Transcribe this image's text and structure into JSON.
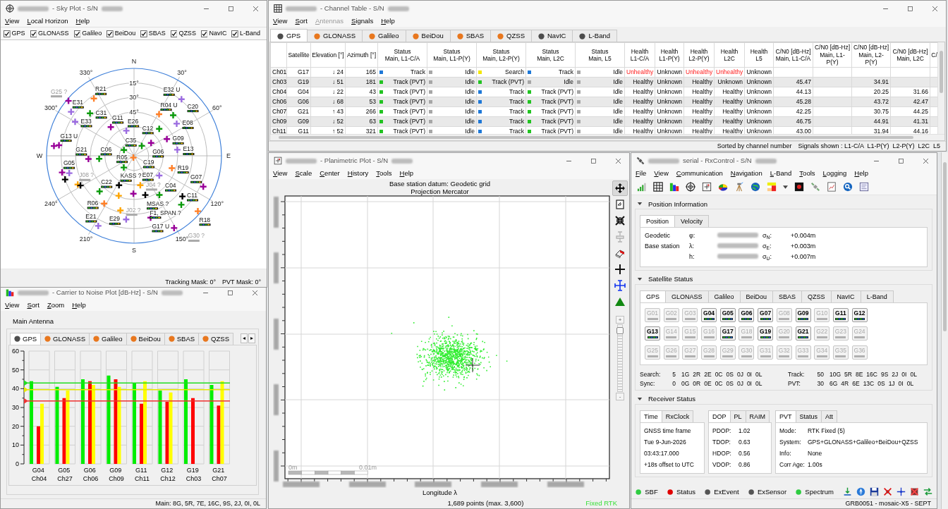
{
  "windows": [
    {
      "kind": "skyplot",
      "title": "- Sky Plot - S/N",
      "menu": [
        "View",
        "Local Horizon",
        "Help"
      ],
      "filters": [
        {
          "label": "GPS",
          "checked": true
        },
        {
          "label": "GLONASS",
          "checked": true
        },
        {
          "label": "Galileo",
          "checked": true
        },
        {
          "label": "BeiDou",
          "checked": true
        },
        {
          "label": "SBAS",
          "checked": true
        },
        {
          "label": "QZSS",
          "checked": true
        },
        {
          "label": "NavIC",
          "checked": true
        },
        {
          "label": "L-Band",
          "checked": true
        }
      ],
      "sky_plot": {
        "compass_labels": [
          "N",
          "30°",
          "60°",
          "E",
          "120°",
          "150°",
          "S",
          "210°",
          "240°",
          "W",
          "300°",
          "330°"
        ],
        "ring_labels": [
          "15°",
          "30°",
          "45°"
        ],
        "satellites": [
          {
            "label": "G25 ?",
            "color": "#990099",
            "tracked": false
          },
          {
            "label": "R21",
            "color": "#ff7f27",
            "tracked": true
          },
          {
            "label": "E31",
            "color": "#9b6ce0",
            "tracked": true
          },
          {
            "label": "C31",
            "color": "#0a9a0a",
            "tracked": true
          },
          {
            "label": "E33",
            "color": "#9b6ce0",
            "tracked": true
          },
          {
            "label": "E32 U",
            "color": "#9b6ce0",
            "tracked": true
          },
          {
            "label": "R04 U",
            "color": "#ff7f27",
            "tracked": true
          },
          {
            "label": "E08",
            "color": "#9b6ce0",
            "tracked": true
          },
          {
            "label": "C20",
            "color": "#0a9a0a",
            "tracked": true
          },
          {
            "label": "G11",
            "color": "#990099",
            "tracked": true
          },
          {
            "label": "E26",
            "color": "#9b6ce0",
            "tracked": true
          },
          {
            "label": "C12",
            "color": "#0a9a0a",
            "tracked": true
          },
          {
            "label": "G06",
            "color": "#990099",
            "tracked": true
          },
          {
            "label": "G09",
            "color": "#990099",
            "tracked": true
          },
          {
            "label": "G13 U",
            "color": "#990099",
            "tracked": true
          },
          {
            "label": "E13",
            "color": "#9b6ce0",
            "tracked": true
          },
          {
            "label": "C35",
            "color": "#0a9a0a",
            "tracked": true
          },
          {
            "label": "C19",
            "color": "#0a9a0a",
            "tracked": true
          },
          {
            "label": "R05",
            "color": "#ff7f27",
            "tracked": true
          },
          {
            "label": "G21",
            "color": "#990099",
            "tracked": true
          },
          {
            "label": "C06",
            "color": "#0a9a0a",
            "tracked": true
          },
          {
            "label": "R19",
            "color": "#ff7f27",
            "tracked": true
          },
          {
            "label": "E07",
            "color": "#9b6ce0",
            "tracked": true
          },
          {
            "label": "G05",
            "color": "#990099",
            "tracked": true
          },
          {
            "label": "J08 ?",
            "color": "#ffa500",
            "tracked": false
          },
          {
            "label": "C22",
            "color": "#0a9a0a",
            "tracked": true
          },
          {
            "label": "KASS ?",
            "color": "#000000",
            "tracked": true
          },
          {
            "label": "J04 ?",
            "color": "#ffa500",
            "tracked": false
          },
          {
            "label": "MSAS ?",
            "color": "#000000",
            "tracked": true
          },
          {
            "label": "C04",
            "color": "#0a9a0a",
            "tracked": true
          },
          {
            "label": "G07",
            "color": "#990099",
            "tracked": true
          },
          {
            "label": "F1, SPAN ?",
            "color": "#000000",
            "tracked": true
          },
          {
            "label": "R06",
            "color": "#ff7f27",
            "tracked": true
          },
          {
            "label": "C11",
            "color": "#0a9a0a",
            "tracked": true
          },
          {
            "label": "R18",
            "color": "#ff7f27",
            "tracked": true
          },
          {
            "label": "J02 ?",
            "color": "#ffa500",
            "tracked": false
          },
          {
            "label": "E29",
            "color": "#9b6ce0",
            "tracked": true
          },
          {
            "label": "G17 U",
            "color": "#990099",
            "tracked": true
          },
          {
            "label": "E21",
            "color": "#9b6ce0",
            "tracked": true
          },
          {
            "label": "G30 ?",
            "color": "#990099",
            "tracked": false
          }
        ],
        "unlabeled_markers": [
          {
            "color": "#990099"
          },
          {
            "color": "#990099"
          },
          {
            "color": "#9b6ce0"
          },
          {
            "color": "#0a9a0a"
          },
          {
            "color": "#000000"
          },
          {
            "color": "#000000"
          },
          {
            "color": "#ffa500"
          }
        ]
      },
      "status_bar": [
        "Tracking Mask: 0°",
        "PVT Mask: 0°"
      ]
    },
    {
      "kind": "channels",
      "title": "- Channel Table - S/N",
      "menu": [
        {
          "label": "View",
          "disabled": false
        },
        {
          "label": "Sort",
          "disabled": false
        },
        {
          "label": "Antennas",
          "disabled": true
        },
        {
          "label": "Signals",
          "disabled": false
        },
        {
          "label": "Help",
          "disabled": false
        }
      ],
      "tabs": [
        {
          "label": "GPS",
          "selected": true,
          "color": "#4d4d4d"
        },
        {
          "label": "GLONASS",
          "selected": false,
          "color": "#e8771e"
        },
        {
          "label": "Galileo",
          "selected": false,
          "color": "#e8771e"
        },
        {
          "label": "BeiDou",
          "selected": false,
          "color": "#e8771e"
        },
        {
          "label": "SBAS",
          "selected": false,
          "color": "#e8771e"
        },
        {
          "label": "QZSS",
          "selected": false,
          "color": "#e8771e"
        },
        {
          "label": "NavIC",
          "selected": false,
          "color": "#4d4d4d"
        },
        {
          "label": "L-Band",
          "selected": false,
          "color": "#4d4d4d"
        }
      ],
      "columns": [
        "Satellite",
        "Elevation [°]",
        "Azimuth [°]",
        "Status\nMain, L1-C/A",
        "Status\nMain, L1-P(Y)",
        "Status\nMain, L2-P(Y)",
        "Status\nMain, L2C",
        "Status\nMain, L5",
        "Health\nL1-C/A",
        "Health\nL1-P(Y)",
        "Health\nL2-P(Y)",
        "Health\nL2C",
        "Health\nL5",
        "C/N0 [dB-Hz]\nMain, L1-C/A",
        "C/N0 [dB-Hz]\nMain, L1-P(Y)",
        "C/N0 [dB-Hz]\nMain, L2-P(Y)",
        "C/N0 [dB-Hz]\nMain, L2C",
        "C/"
      ],
      "rows": [
        {
          "channel": "Ch01",
          "satellite": "G17",
          "elevation": "↓ 24",
          "azimuth": "165",
          "status": [
            {
              "text": "Track",
              "color": "#1e78d7"
            },
            {
              "text": "Idle",
              "color": "#a6a6a6"
            },
            {
              "text": "Search",
              "color": "#f2e600"
            },
            {
              "text": "Track",
              "color": "#1e78d7"
            },
            {
              "text": "Idle",
              "color": "#a6a6a6"
            }
          ],
          "health": [
            {
              "text": "Unhealthy",
              "alert": true
            },
            {
              "text": "Unknown",
              "alert": false
            },
            {
              "text": "Unhealthy",
              "alert": true
            },
            {
              "text": "Unhealthy",
              "alert": true
            },
            {
              "text": "Unknown",
              "alert": false
            }
          ]
        },
        {
          "channel": "Ch03",
          "satellite": "G19",
          "elevation": "↓ 51",
          "azimuth": "181",
          "status": [
            {
              "text": "Track (PVT)",
              "color": "#22c322"
            },
            {
              "text": "Idle",
              "color": "#a6a6a6"
            },
            {
              "text": "Track (PVT)",
              "color": "#22c322"
            },
            {
              "text": "Idle",
              "color": "#a6a6a6"
            },
            {
              "text": "Idle",
              "color": "#a6a6a6"
            }
          ],
          "health": [
            {
              "text": "Healthy",
              "alert": false
            },
            {
              "text": "Unknown",
              "alert": false
            },
            {
              "text": "Healthy",
              "alert": false
            },
            {
              "text": "Unknown",
              "alert": false
            },
            {
              "text": "Unknown",
              "alert": false
            }
          ],
          "cn0": {
            "main_l1ca": "45.47",
            "main_l2py": "34.91"
          }
        },
        {
          "channel": "Ch04",
          "satellite": "G04",
          "elevation": "↓ 22",
          "azimuth": "43",
          "status": [
            {
              "text": "Track (PVT)",
              "color": "#22c322"
            },
            {
              "text": "Idle",
              "color": "#a6a6a6"
            },
            {
              "text": "Track",
              "color": "#1e78d7"
            },
            {
              "text": "Track (PVT)",
              "color": "#22c322"
            },
            {
              "text": "Idle",
              "color": "#a6a6a6"
            }
          ],
          "health": [
            {
              "text": "Healthy",
              "alert": false
            },
            {
              "text": "Unknown",
              "alert": false
            },
            {
              "text": "Healthy",
              "alert": false
            },
            {
              "text": "Healthy",
              "alert": false
            },
            {
              "text": "Unknown",
              "alert": false
            }
          ],
          "cn0": {
            "main_l1ca": "44.13",
            "main_l2py": "20.25",
            "main_l2c": "31.66"
          }
        },
        {
          "channel": "Ch06",
          "satellite": "G06",
          "elevation": "↓ 68",
          "azimuth": "53",
          "status": [
            {
              "text": "Track (PVT)",
              "color": "#22c322"
            },
            {
              "text": "Idle",
              "color": "#a6a6a6"
            },
            {
              "text": "Track",
              "color": "#1e78d7"
            },
            {
              "text": "Track (PVT)",
              "color": "#22c322"
            },
            {
              "text": "Idle",
              "color": "#a6a6a6"
            }
          ],
          "health": [
            {
              "text": "Healthy",
              "alert": false
            },
            {
              "text": "Unknown",
              "alert": false
            },
            {
              "text": "Healthy",
              "alert": false
            },
            {
              "text": "Healthy",
              "alert": false
            },
            {
              "text": "Unknown",
              "alert": false
            }
          ],
          "cn0": {
            "main_l1ca": "45.28",
            "main_l2py": "43.72",
            "main_l2c": "42.47"
          }
        },
        {
          "channel": "Ch07",
          "satellite": "G21",
          "elevation": "↑ 43",
          "azimuth": "266",
          "status": [
            {
              "text": "Track (PVT)",
              "color": "#22c322"
            },
            {
              "text": "Idle",
              "color": "#a6a6a6"
            },
            {
              "text": "Track",
              "color": "#1e78d7"
            },
            {
              "text": "Track (PVT)",
              "color": "#22c322"
            },
            {
              "text": "Idle",
              "color": "#a6a6a6"
            }
          ],
          "health": [
            {
              "text": "Healthy",
              "alert": false
            },
            {
              "text": "Unknown",
              "alert": false
            },
            {
              "text": "Healthy",
              "alert": false
            },
            {
              "text": "Healthy",
              "alert": false
            },
            {
              "text": "Unknown",
              "alert": false
            }
          ],
          "cn0": {
            "main_l1ca": "42.25",
            "main_l2py": "30.75",
            "main_l2c": "44.25"
          }
        },
        {
          "channel": "Ch09",
          "satellite": "G09",
          "elevation": "↓ 52",
          "azimuth": "63",
          "status": [
            {
              "text": "Track (PVT)",
              "color": "#22c322"
            },
            {
              "text": "Idle",
              "color": "#a6a6a6"
            },
            {
              "text": "Track",
              "color": "#1e78d7"
            },
            {
              "text": "Track (PVT)",
              "color": "#22c322"
            },
            {
              "text": "Idle",
              "color": "#a6a6a6"
            }
          ],
          "health": [
            {
              "text": "Healthy",
              "alert": false
            },
            {
              "text": "Unknown",
              "alert": false
            },
            {
              "text": "Healthy",
              "alert": false
            },
            {
              "text": "Healthy",
              "alert": false
            },
            {
              "text": "Unknown",
              "alert": false
            }
          ],
          "cn0": {
            "main_l1ca": "46.75",
            "main_l2py": "44.91",
            "main_l2c": "41.31"
          }
        },
        {
          "channel": "Ch11",
          "satellite": "G11",
          "elevation": "↑ 52",
          "azimuth": "321",
          "status": [
            {
              "text": "Track (PVT)",
              "color": "#22c322"
            },
            {
              "text": "Idle",
              "color": "#a6a6a6"
            },
            {
              "text": "Track",
              "color": "#1e78d7"
            },
            {
              "text": "Track (PVT)",
              "color": "#22c322"
            },
            {
              "text": "Idle",
              "color": "#a6a6a6"
            }
          ],
          "health": [
            {
              "text": "Healthy",
              "alert": false
            },
            {
              "text": "Unknown",
              "alert": false
            },
            {
              "text": "Healthy",
              "alert": false
            },
            {
              "text": "Healthy",
              "alert": false
            },
            {
              "text": "Unknown",
              "alert": false
            }
          ],
          "cn0": {
            "main_l1ca": "43.00",
            "main_l2py": "31.94",
            "main_l2c": "44.16"
          }
        }
      ],
      "status_bar": [
        "Sorted by channel number",
        "Signals shown : L1-C/A  L1-P(Y)  L2-P(Y)  L2C  L5"
      ]
    },
    {
      "kind": "cn0",
      "title": "- Carrier to Noise Plot [dB-Hz] - S/N",
      "menu": [
        "View",
        "Sort",
        "Zoom",
        "Help"
      ],
      "group_label": "Main Antenna",
      "tabs": [
        {
          "label": "GPS",
          "selected": true,
          "color": "#4d4d4d"
        },
        {
          "label": "GLONASS",
          "selected": false,
          "color": "#e8771e"
        },
        {
          "label": "Galileo",
          "selected": false,
          "color": "#e8771e"
        },
        {
          "label": "BeiDou",
          "selected": false,
          "color": "#e8771e"
        },
        {
          "label": "SBAS",
          "selected": false,
          "color": "#e8771e"
        },
        {
          "label": "QZSS",
          "selected": false,
          "color": "#e8771e"
        }
      ],
      "tab_scroll": [
        "◂",
        "▸"
      ],
      "chart_data": {
        "type": "bar",
        "categories": [
          "G04\nCh04",
          "G05\nCh27",
          "G06\nCh06",
          "G09\nCh09",
          "G11\nCh11",
          "G12\nCh12",
          "G19\nCh03",
          "G21\nCh07"
        ],
        "series": [
          {
            "color": "#00ee00",
            "values": [
              44,
              41,
              45,
              47,
              43,
              39,
              45,
              42
            ]
          },
          {
            "color": "#ff0000",
            "values": [
              20,
              35,
              44,
              45,
              32,
              33,
              35,
              31
            ]
          },
          {
            "color": "#ffff00",
            "values": [
              32,
              39,
              42,
              41,
              44,
              38,
              null,
              44
            ]
          }
        ],
        "ylim": [
          0,
          60
        ],
        "yticks": [
          0,
          10,
          20,
          30,
          40,
          50,
          60
        ],
        "grid": true,
        "ref_lines": [
          {
            "axis": "y",
            "value": 43,
            "color": "#22dd22"
          },
          {
            "axis": "y",
            "value": 39.5,
            "color": "#e6e600"
          },
          {
            "axis": "y",
            "value": 33.5,
            "color": "#ee3333"
          }
        ]
      },
      "status_bar": "Main: 8G, 5R, 7E, 16C, 9S, 2J, 0I, 0L"
    },
    {
      "kind": "planimetric",
      "title": "- Planimetric Plot - S/N",
      "menu": [
        "View",
        "Scale",
        "Center",
        "History",
        "Tools",
        "Help"
      ],
      "heading": [
        "Base station datum: Geodetic grid",
        "Projection Mercator"
      ],
      "scale_labels": [
        "0m",
        "0.01m"
      ],
      "x_axis_title": "Longitude λ",
      "points_info": "1,689 points (max. 3,600)",
      "solution": "Fixed RTK",
      "tools": [
        {
          "kind": "pan",
          "selected": true,
          "disabled": false
        },
        {
          "kind": "export",
          "selected": false,
          "disabled": false
        },
        {
          "kind": "fit",
          "selected": false,
          "disabled": false
        },
        {
          "kind": "measure",
          "selected": false,
          "disabled": true
        },
        {
          "kind": "eraser",
          "selected": false,
          "disabled": false
        },
        {
          "kind": "cross",
          "selected": false,
          "disabled": false
        },
        {
          "kind": "crosshair",
          "selected": false,
          "disabled": false
        },
        {
          "kind": "triangle",
          "selected": false,
          "disabled": false
        }
      ],
      "zoom_slider": {
        "level": 0.97,
        "plus": "+",
        "minus": "-"
      }
    },
    {
      "kind": "rxcontrol",
      "title": "serial - RxControl - S/N",
      "menu": [
        "File",
        "View",
        "Communication",
        "Navigation",
        "L-Band",
        "Tools",
        "Logging",
        "Help"
      ],
      "toolbar": [
        {
          "kind": "signal"
        },
        {
          "kind": "table"
        },
        {
          "kind": "cn0"
        },
        {
          "kind": "sky"
        },
        {
          "kind": "planimetric"
        },
        {
          "kind": "pie"
        },
        {
          "kind": "tripod"
        },
        {
          "kind": "globe"
        },
        {
          "kind": "palette"
        },
        {
          "kind": "caret"
        },
        {
          "kind": "spectrum"
        },
        {
          "kind": "satellite"
        },
        {
          "kind": "chart"
        },
        {
          "kind": "search"
        },
        {
          "kind": "document"
        }
      ],
      "position_information": {
        "title": "Position Information",
        "expanded": true,
        "tabs": [
          {
            "label": "Position",
            "selected": true
          },
          {
            "label": "Velocity",
            "selected": false
          }
        ],
        "rows": [
          {
            "label": "Geodetic",
            "coordinate": "φ:",
            "sigma": "σ$_{N}$:",
            "sigma_value": "+0.004m"
          },
          {
            "label": "Base station",
            "coordinate": "λ:",
            "sigma": "σ$_{E}$:",
            "sigma_value": "+0.003m"
          },
          {
            "coordinate": "h:",
            "sigma": "σ$_{U}$:",
            "sigma_value": "+0.007m"
          }
        ]
      },
      "satellite_status": {
        "title": "Satellite Status",
        "expanded": true,
        "tabs": [
          {
            "label": "GPS",
            "selected": true
          },
          {
            "label": "GLONASS",
            "selected": false
          },
          {
            "label": "Galileo",
            "selected": false
          },
          {
            "label": "BeiDou",
            "selected": false
          },
          {
            "label": "SBAS",
            "selected": false
          },
          {
            "label": "QZSS",
            "selected": false
          },
          {
            "label": "NavIC",
            "selected": false
          },
          {
            "label": "L-Band",
            "selected": false
          }
        ],
        "satellites": [
          {
            "label": "G01",
            "tracked": false
          },
          {
            "label": "G02",
            "tracked": false
          },
          {
            "label": "G03",
            "tracked": false
          },
          {
            "label": "G04",
            "tracked": true
          },
          {
            "label": "G05",
            "tracked": true
          },
          {
            "label": "G06",
            "tracked": true
          },
          {
            "label": "G07",
            "tracked": true
          },
          {
            "label": "G08",
            "tracked": false
          },
          {
            "label": "G09",
            "tracked": true
          },
          {
            "label": "G10",
            "tracked": false
          },
          {
            "label": "G11",
            "tracked": true
          },
          {
            "label": "G12",
            "tracked": true
          },
          {
            "label": "G13",
            "tracked": true
          },
          {
            "label": "G14",
            "tracked": false
          },
          {
            "label": "G15",
            "tracked": false
          },
          {
            "label": "G16",
            "tracked": false
          },
          {
            "label": "G17",
            "tracked": true
          },
          {
            "label": "G18",
            "tracked": false
          },
          {
            "label": "G19",
            "tracked": true
          },
          {
            "label": "G20",
            "tracked": false
          },
          {
            "label": "G21",
            "tracked": true
          },
          {
            "label": "G22",
            "tracked": false
          },
          {
            "label": "G23",
            "tracked": false
          },
          {
            "label": "G24",
            "tracked": false
          },
          {
            "label": "G25",
            "tracked": false
          },
          {
            "label": "G26",
            "tracked": false
          },
          {
            "label": "G27",
            "tracked": false
          },
          {
            "label": "G28",
            "tracked": false
          },
          {
            "label": "G29",
            "tracked": false
          },
          {
            "label": "G30",
            "tracked": false
          },
          {
            "label": "G31",
            "tracked": false
          },
          {
            "label": "G32",
            "tracked": false
          },
          {
            "label": "G33",
            "tracked": false
          },
          {
            "label": "G34",
            "tracked": false
          },
          {
            "label": "G35",
            "tracked": false
          },
          {
            "label": "G36",
            "tracked": false
          }
        ],
        "counts": [
          {
            "label": "Search:",
            "total": "5",
            "values": [
              "1G",
              "2R",
              "2E",
              "0C",
              "0S",
              "0J",
              "0I",
              "0L"
            ]
          },
          {
            "label": "Track:",
            "total": "50",
            "values": [
              "10G",
              "5R",
              "8E",
              "16C",
              "9S",
              "2J",
              "0I",
              "0L"
            ]
          },
          {
            "label": "Sync:",
            "total": "0",
            "values": [
              "0G",
              "0R",
              "0E",
              "0C",
              "0S",
              "0J",
              "0I",
              "0L"
            ]
          },
          {
            "label": "PVT:",
            "total": "30",
            "values": [
              "6G",
              "4R",
              "6E",
              "13C",
              "0S",
              "1J",
              "0I",
              "0L"
            ]
          }
        ]
      },
      "receiver_status": {
        "title": "Receiver Status",
        "expanded": true,
        "panels": [
          {
            "tabs": [
              {
                "label": "Time",
                "selected": true
              },
              {
                "label": "RxClock",
                "selected": false
              }
            ],
            "rows": [
              [
                "GNSS time frame"
              ],
              [
                "Tue 9-Jun-2026"
              ],
              [
                "03:43:17.000"
              ],
              [
                "+18s offset to UTC"
              ]
            ]
          },
          {
            "tabs": [
              {
                "label": "DOP",
                "selected": true
              },
              {
                "label": "PL",
                "selected": false
              },
              {
                "label": "RAIM",
                "selected": false
              }
            ],
            "rows": [
              [
                "PDOP:",
                "1.02"
              ],
              [
                "TDOP:",
                "0.63"
              ],
              [
                "HDOP:",
                "0.56"
              ],
              [
                "VDOP:",
                "0.86"
              ]
            ]
          },
          {
            "tabs": [
              {
                "label": "PVT",
                "selected": true
              },
              {
                "label": "Status",
                "selected": false
              },
              {
                "label": "Att",
                "selected": false
              }
            ],
            "rows": [
              [
                "Mode:",
                "RTK Fixed (5)"
              ],
              [
                "System:",
                "GPS+GLONASS+Galileo+BeiDou+QZSS"
              ],
              [
                "Info:",
                "None"
              ],
              [
                "Corr Age:",
                "1.00s"
              ]
            ]
          }
        ]
      },
      "indicators": [
        {
          "label": "SBF",
          "color": "#2ecc40"
        },
        {
          "label": "Status",
          "color": "#e00000"
        },
        {
          "label": "ExEvent",
          "color": "#555555"
        },
        {
          "label": "ExSensor",
          "color": "#555555"
        },
        {
          "label": "Spectrum",
          "color": "#2ecc40"
        }
      ],
      "status_icons": [
        {
          "kind": "download"
        },
        {
          "kind": "north"
        },
        {
          "kind": "disk"
        },
        {
          "kind": "nosignal"
        },
        {
          "kind": "crosshair"
        },
        {
          "kind": "nolog"
        },
        {
          "kind": "arrows"
        }
      ],
      "status_bar": "GRB0051 - mosaic-X5 - SEPT"
    }
  ]
}
